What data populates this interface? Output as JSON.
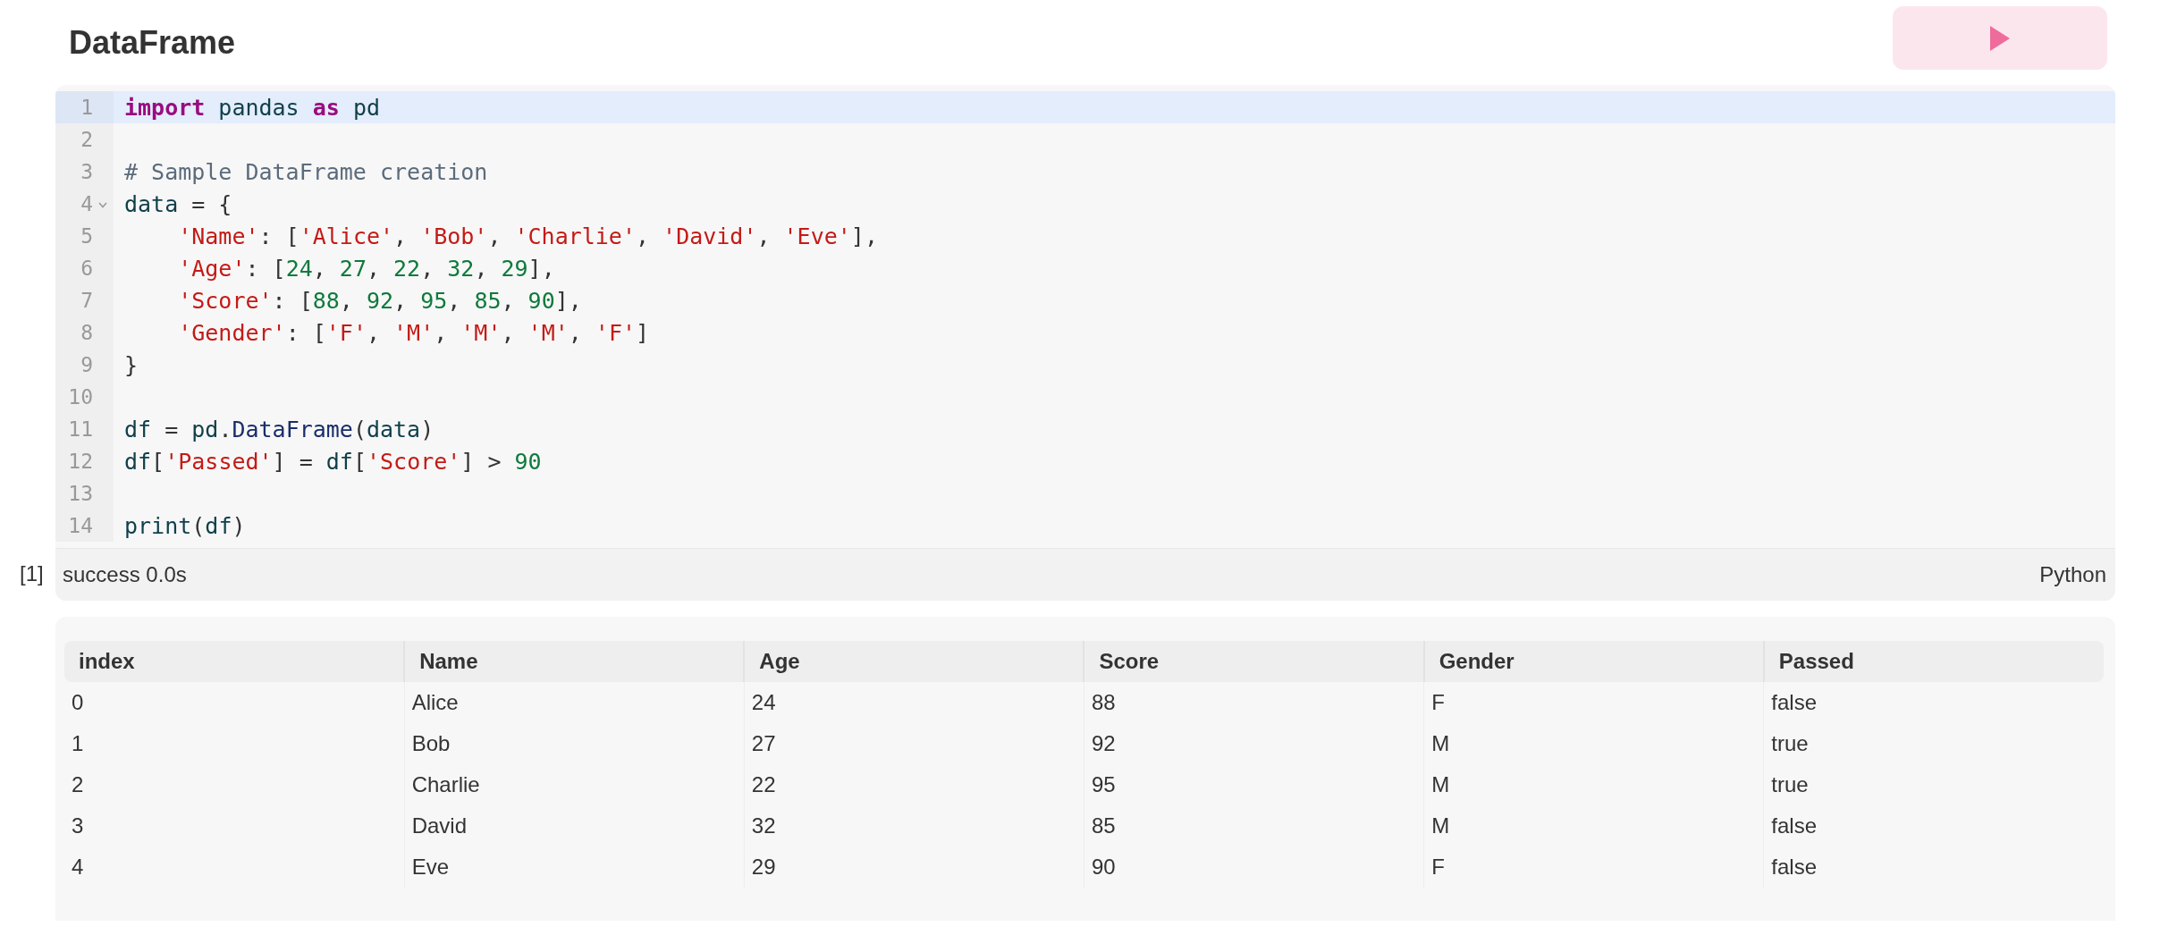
{
  "title": "DataFrame",
  "code": {
    "lines": [
      {
        "number": "1",
        "active": true,
        "foldable": false,
        "tokens": [
          {
            "kind": "keyword",
            "text": "import"
          },
          {
            "kind": "name",
            "text": " pandas "
          },
          {
            "kind": "keyword",
            "text": "as"
          },
          {
            "kind": "name",
            "text": " pd"
          }
        ]
      },
      {
        "number": "2",
        "active": false,
        "foldable": false
      },
      {
        "number": "3",
        "active": false,
        "foldable": false,
        "tokens": [
          {
            "kind": "comment",
            "text": "# Sample DataFrame creation"
          }
        ]
      },
      {
        "number": "4",
        "active": false,
        "foldable": true,
        "tokens": [
          {
            "kind": "name",
            "text": "data"
          },
          {
            "kind": "plain",
            "text": " = {"
          }
        ]
      },
      {
        "number": "5",
        "active": false,
        "foldable": false,
        "tokens": [
          {
            "kind": "string",
            "text": "    'Name'"
          },
          {
            "kind": "plain",
            "text": ": ["
          },
          {
            "kind": "string",
            "text": "'Alice'"
          },
          {
            "kind": "plain",
            "text": ", "
          },
          {
            "kind": "string",
            "text": "'Bob'"
          },
          {
            "kind": "plain",
            "text": ", "
          },
          {
            "kind": "string",
            "text": "'Charlie'"
          },
          {
            "kind": "plain",
            "text": ", "
          },
          {
            "kind": "string",
            "text": "'David'"
          },
          {
            "kind": "plain",
            "text": ", "
          },
          {
            "kind": "string",
            "text": "'Eve'"
          },
          {
            "kind": "plain",
            "text": "],"
          }
        ]
      },
      {
        "number": "6",
        "active": false,
        "foldable": false,
        "tokens": [
          {
            "kind": "string",
            "text": "    'Age'"
          },
          {
            "kind": "plain",
            "text": ": ["
          },
          {
            "kind": "number",
            "text": "24"
          },
          {
            "kind": "plain",
            "text": ", "
          },
          {
            "kind": "number",
            "text": "27"
          },
          {
            "kind": "plain",
            "text": ", "
          },
          {
            "kind": "number",
            "text": "22"
          },
          {
            "kind": "plain",
            "text": ", "
          },
          {
            "kind": "number",
            "text": "32"
          },
          {
            "kind": "plain",
            "text": ", "
          },
          {
            "kind": "number",
            "text": "29"
          },
          {
            "kind": "plain",
            "text": "],"
          }
        ]
      },
      {
        "number": "7",
        "active": false,
        "foldable": false,
        "tokens": [
          {
            "kind": "string",
            "text": "    'Score'"
          },
          {
            "kind": "plain",
            "text": ": ["
          },
          {
            "kind": "number",
            "text": "88"
          },
          {
            "kind": "plain",
            "text": ", "
          },
          {
            "kind": "number",
            "text": "92"
          },
          {
            "kind": "plain",
            "text": ", "
          },
          {
            "kind": "number",
            "text": "95"
          },
          {
            "kind": "plain",
            "text": ", "
          },
          {
            "kind": "number",
            "text": "85"
          },
          {
            "kind": "plain",
            "text": ", "
          },
          {
            "kind": "number",
            "text": "90"
          },
          {
            "kind": "plain",
            "text": "],"
          }
        ]
      },
      {
        "number": "8",
        "active": false,
        "foldable": false,
        "tokens": [
          {
            "kind": "string",
            "text": "    'Gender'"
          },
          {
            "kind": "plain",
            "text": ": ["
          },
          {
            "kind": "string",
            "text": "'F'"
          },
          {
            "kind": "plain",
            "text": ", "
          },
          {
            "kind": "string",
            "text": "'M'"
          },
          {
            "kind": "plain",
            "text": ", "
          },
          {
            "kind": "string",
            "text": "'M'"
          },
          {
            "kind": "plain",
            "text": ", "
          },
          {
            "kind": "string",
            "text": "'M'"
          },
          {
            "kind": "plain",
            "text": ", "
          },
          {
            "kind": "string",
            "text": "'F'"
          },
          {
            "kind": "plain",
            "text": "]"
          }
        ]
      },
      {
        "number": "9",
        "active": false,
        "foldable": false,
        "tokens": [
          {
            "kind": "plain",
            "text": "}"
          }
        ]
      },
      {
        "number": "10",
        "active": false,
        "foldable": false
      },
      {
        "number": "11",
        "active": false,
        "foldable": false,
        "tokens": [
          {
            "kind": "name",
            "text": "df"
          },
          {
            "kind": "plain",
            "text": " = "
          },
          {
            "kind": "name",
            "text": "pd"
          },
          {
            "kind": "plain",
            "text": "."
          },
          {
            "kind": "function",
            "text": "DataFrame"
          },
          {
            "kind": "plain",
            "text": "("
          },
          {
            "kind": "name",
            "text": "data"
          },
          {
            "kind": "plain",
            "text": ")"
          }
        ]
      },
      {
        "number": "12",
        "active": false,
        "foldable": false,
        "tokens": [
          {
            "kind": "name",
            "text": "df"
          },
          {
            "kind": "plain",
            "text": "["
          },
          {
            "kind": "string",
            "text": "'Passed'"
          },
          {
            "kind": "plain",
            "text": "] = "
          },
          {
            "kind": "name",
            "text": "df"
          },
          {
            "kind": "plain",
            "text": "["
          },
          {
            "kind": "string",
            "text": "'Score'"
          },
          {
            "kind": "plain",
            "text": "] > "
          },
          {
            "kind": "number",
            "text": "90"
          }
        ]
      },
      {
        "number": "13",
        "active": false,
        "foldable": false
      },
      {
        "number": "14",
        "active": false,
        "foldable": false,
        "tokens": [
          {
            "kind": "name",
            "text": "print"
          },
          {
            "kind": "plain",
            "text": "("
          },
          {
            "kind": "name",
            "text": "df"
          },
          {
            "kind": "plain",
            "text": ")"
          }
        ]
      }
    ]
  },
  "execution_count": "[1]",
  "status": "success 0.0s",
  "language": "Python",
  "table": {
    "columns": [
      "index",
      "Name",
      "Age",
      "Score",
      "Gender",
      "Passed"
    ],
    "rows": [
      [
        "0",
        "Alice",
        "24",
        "88",
        "F",
        "false"
      ],
      [
        "1",
        "Bob",
        "27",
        "92",
        "M",
        "true"
      ],
      [
        "2",
        "Charlie",
        "22",
        "95",
        "M",
        "true"
      ],
      [
        "3",
        "David",
        "32",
        "85",
        "M",
        "false"
      ],
      [
        "4",
        "Eve",
        "29",
        "90",
        "F",
        "false"
      ]
    ]
  }
}
